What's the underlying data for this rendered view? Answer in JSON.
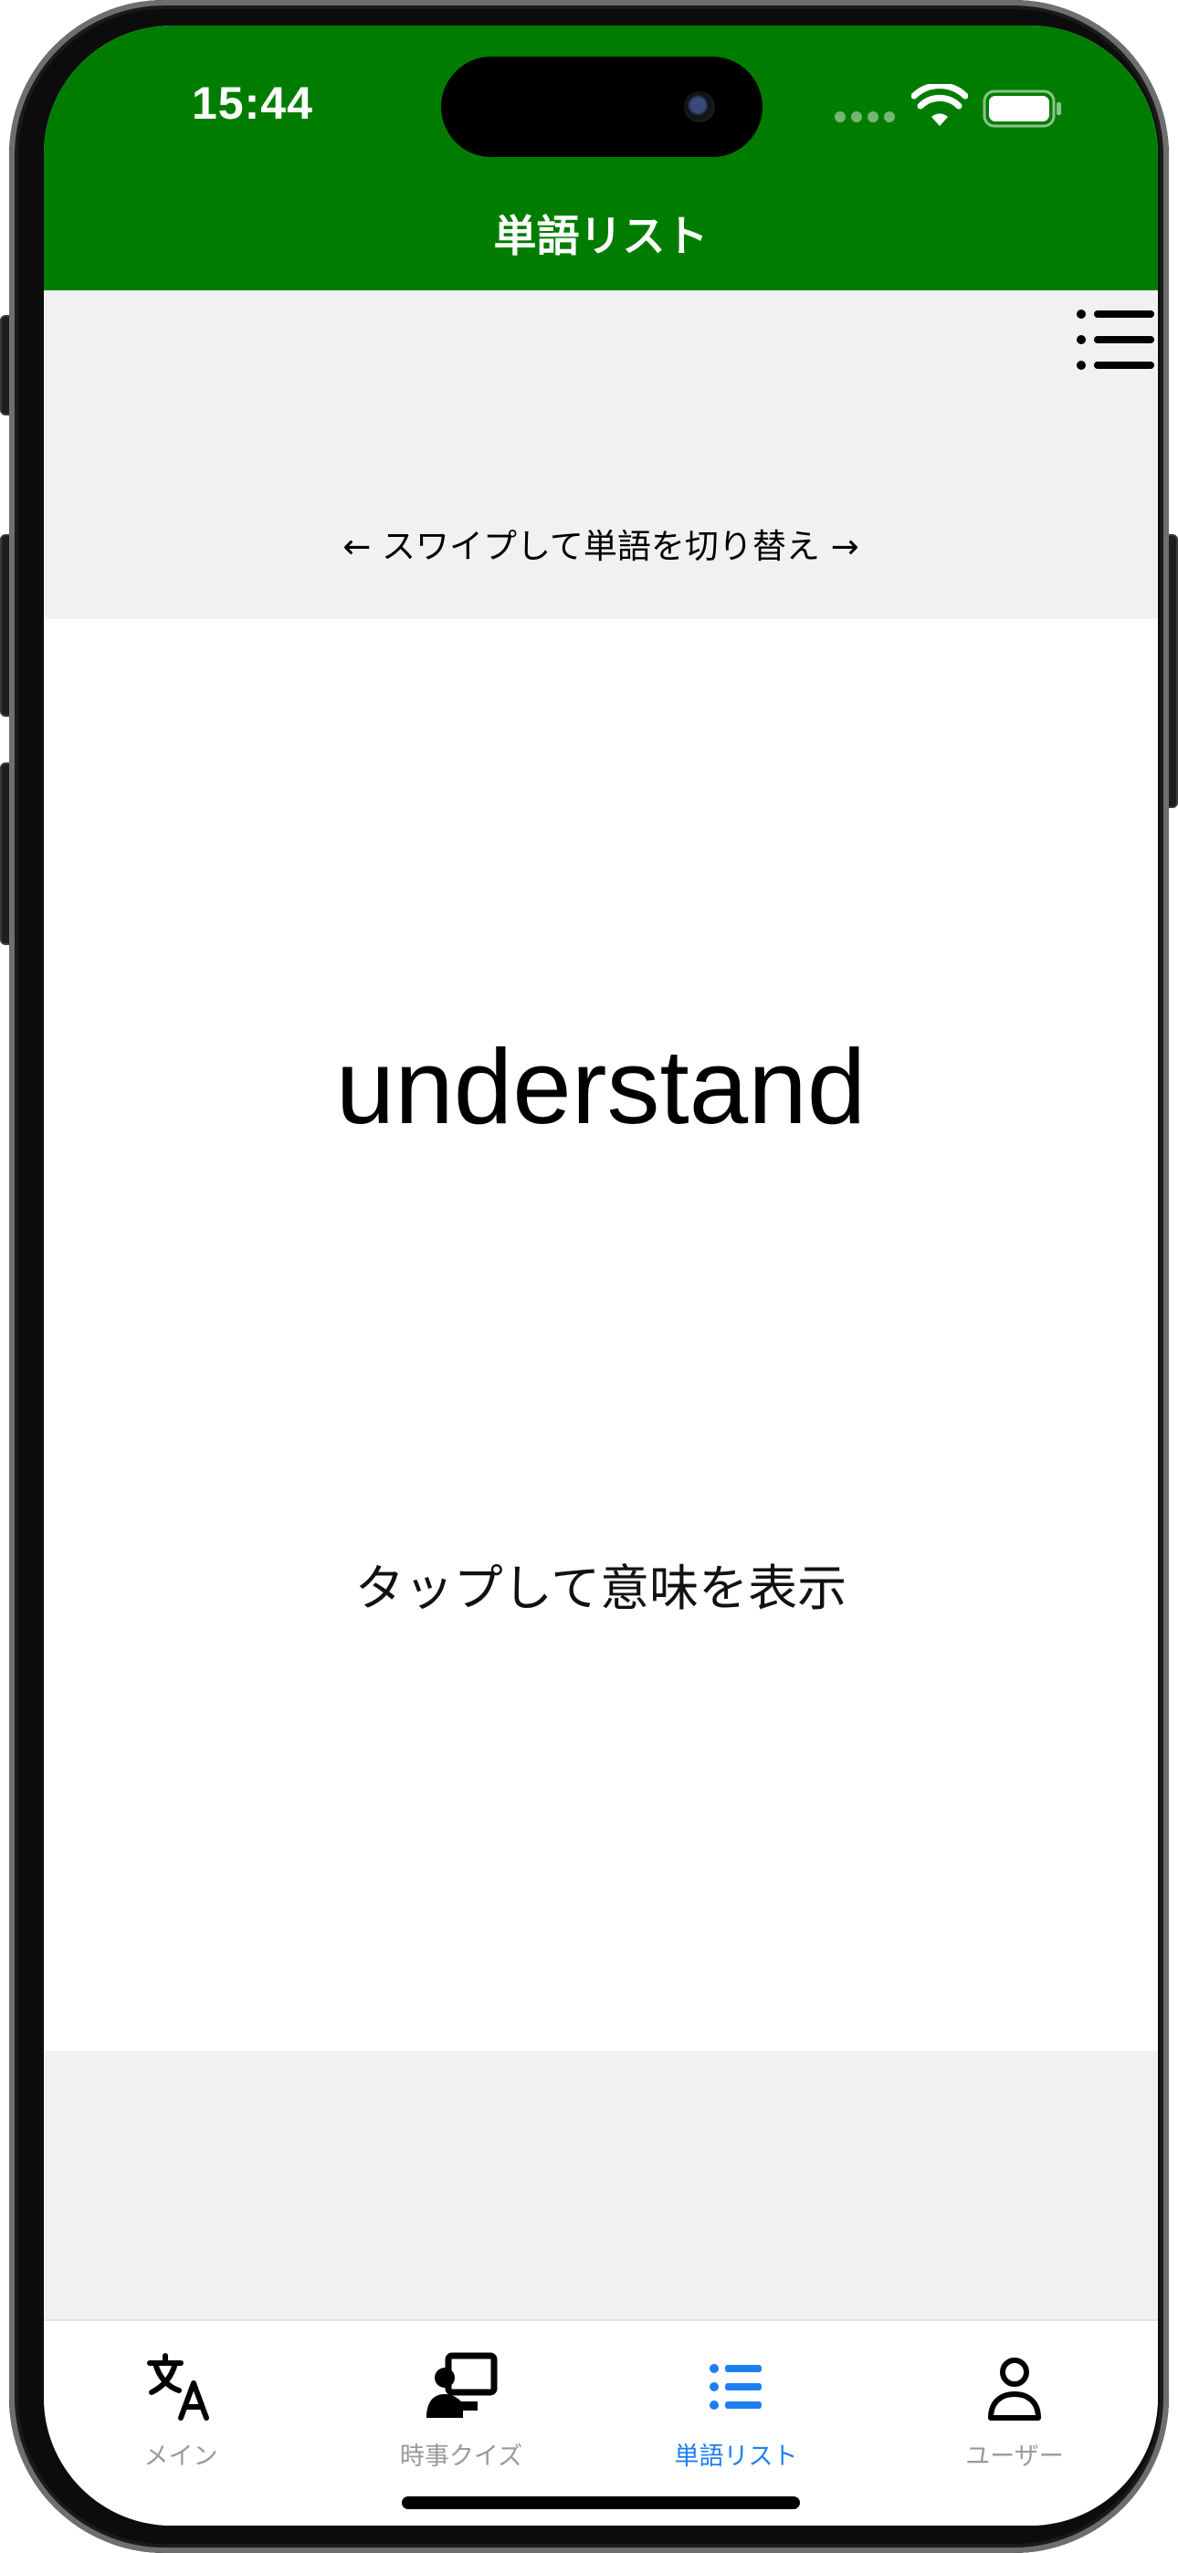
{
  "status_bar": {
    "time": "15:44",
    "icons": [
      "signal-dots-icon",
      "wifi-icon",
      "battery-icon"
    ]
  },
  "header": {
    "title": "単語リスト",
    "background_color": "#007d00"
  },
  "toolbar": {
    "menu_icon": "list-menu-icon"
  },
  "flashcard": {
    "swipe_hint": "← スワイプして単語を切り替え →",
    "word": "understand",
    "tap_hint": "タップして意味を表示"
  },
  "tab_bar": {
    "active_color": "#1e7ff0",
    "inactive_color": "#9a9a9a",
    "tabs": [
      {
        "label": "メイン",
        "icon": "translate-icon",
        "active": false
      },
      {
        "label": "時事クイズ",
        "icon": "presenter-icon",
        "active": false
      },
      {
        "label": "単語リスト",
        "icon": "list-bullet-icon",
        "active": true
      },
      {
        "label": "ユーザー",
        "icon": "person-icon",
        "active": false
      }
    ]
  }
}
